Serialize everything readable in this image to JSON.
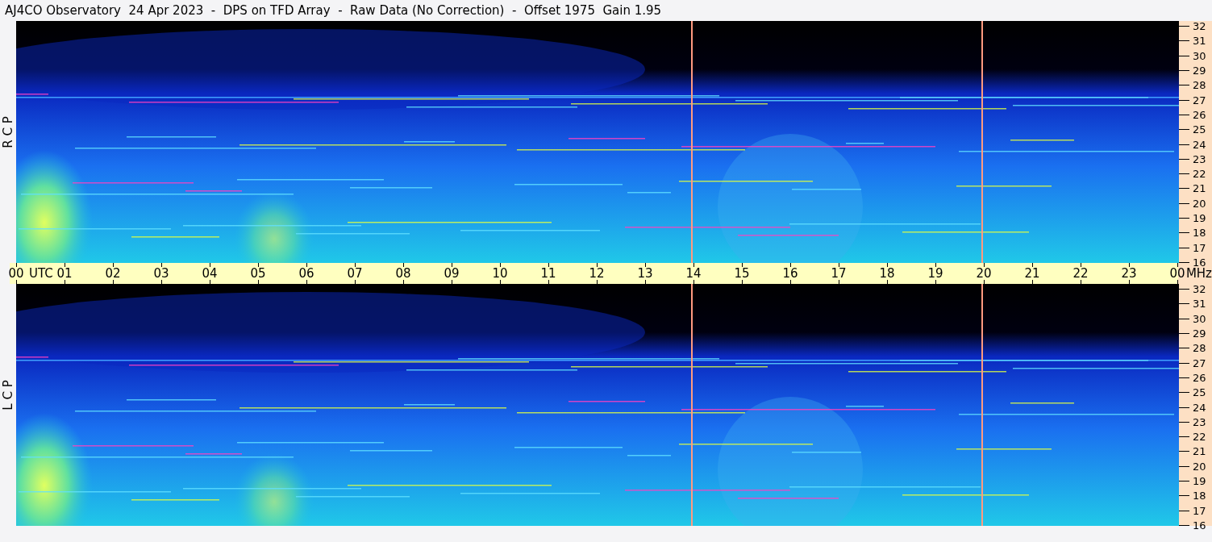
{
  "title": "AJ4CO Observatory  24 Apr 2023  -  DPS on TFD Array  -  Raw Data (No Correction)  -  Offset 1975  Gain 1.95",
  "panels": [
    {
      "label": "R C P",
      "frequency_labels": [
        "32",
        "31",
        "30",
        "29",
        "28",
        "27",
        "26",
        "25",
        "24",
        "23",
        "22",
        "21",
        "20",
        "19",
        "18",
        "17",
        "16"
      ]
    },
    {
      "label": "L C P",
      "frequency_labels": [
        "32",
        "31",
        "30",
        "29",
        "28",
        "27",
        "26",
        "25",
        "24",
        "23",
        "22",
        "21",
        "20",
        "19",
        "18",
        "17",
        "16"
      ]
    }
  ],
  "time_axis": {
    "hour_labels": [
      "00",
      "01",
      "02",
      "03",
      "04",
      "05",
      "06",
      "07",
      "08",
      "09",
      "10",
      "11",
      "12",
      "13",
      "14",
      "15",
      "16",
      "17",
      "18",
      "19",
      "20",
      "21",
      "22",
      "23",
      "00"
    ],
    "zone": "UTC",
    "unit": "MHz"
  }
}
